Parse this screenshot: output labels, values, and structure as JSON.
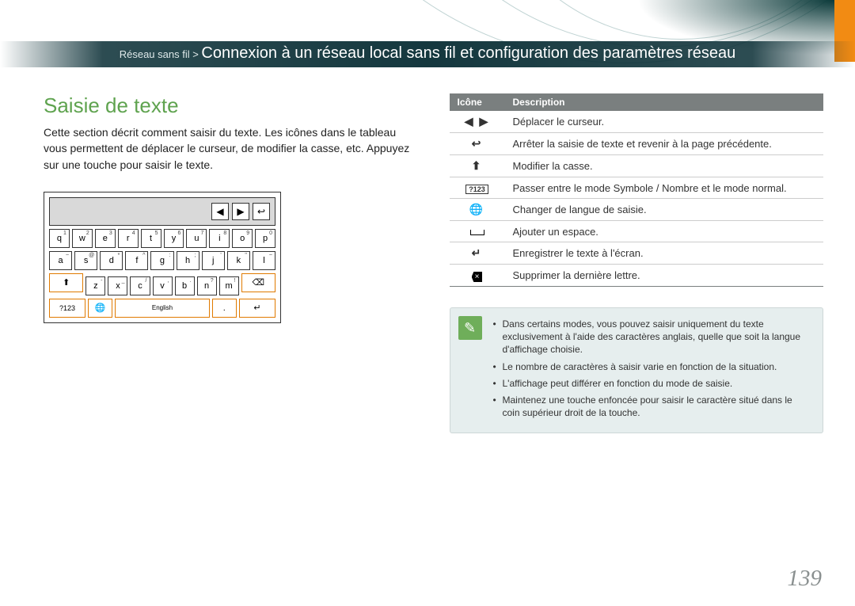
{
  "breadcrumb": {
    "prefix": "Réseau sans fil > ",
    "title": "Connexion à un réseau local sans fil et configuration des paramètres réseau"
  },
  "section_title": "Saisie de texte",
  "intro": "Cette section décrit comment saisir du texte. Les icônes dans le tableau vous permettent de déplacer le curseur, de modifier la casse, etc. Appuyez sur une touche pour saisir le texte.",
  "keyboard": {
    "row1": [
      {
        "k": "q",
        "s": "1"
      },
      {
        "k": "w",
        "s": "2"
      },
      {
        "k": "e",
        "s": "3"
      },
      {
        "k": "r",
        "s": "4"
      },
      {
        "k": "t",
        "s": "5"
      },
      {
        "k": "y",
        "s": "6"
      },
      {
        "k": "u",
        "s": "7"
      },
      {
        "k": "i",
        "s": "8"
      },
      {
        "k": "o",
        "s": "9"
      },
      {
        "k": "p",
        "s": "0"
      }
    ],
    "row2": [
      {
        "k": "a",
        "s": "~"
      },
      {
        "k": "s",
        "s": "@"
      },
      {
        "k": "d",
        "s": "*"
      },
      {
        "k": "f",
        "s": "^"
      },
      {
        "k": "g",
        "s": ":"
      },
      {
        "k": "h",
        "s": ";"
      },
      {
        "k": "j",
        "s": "'"
      },
      {
        "k": "k",
        "s": "\""
      },
      {
        "k": "l",
        "s": "~"
      }
    ],
    "row3": [
      {
        "k": "z",
        "s": "-"
      },
      {
        "k": "x",
        "s": "_"
      },
      {
        "k": "c",
        "s": "/"
      },
      {
        "k": "v",
        "s": ","
      },
      {
        "k": "b",
        "s": "."
      },
      {
        "k": "n",
        "s": "?"
      },
      {
        "k": "m",
        "s": "!"
      }
    ],
    "mode_key": "?123",
    "lang_key": "English",
    "dot_key": ".",
    "shift_icon": "⬆",
    "back_icon": "⌫",
    "enter_icon": "↵",
    "left_icon": "◀",
    "right_icon": "▶",
    "return_icon": "↩"
  },
  "table": {
    "headers": {
      "icon": "Icône",
      "desc": "Description"
    },
    "rows": [
      {
        "icon": "◀ ▶",
        "desc": "Déplacer le curseur."
      },
      {
        "icon": "↩",
        "desc": "Arrêter la saisie de texte et revenir à la page précédente."
      },
      {
        "icon": "⬆",
        "desc": "Modifier la casse."
      },
      {
        "icon": "?123",
        "desc": "Passer entre le mode Symbole / Nombre et le mode normal."
      },
      {
        "icon": "🌐",
        "desc": "Changer de langue de saisie."
      },
      {
        "icon": "␣",
        "desc": "Ajouter un espace."
      },
      {
        "icon": "↵",
        "desc": "Enregistrer le texte à l'écran."
      },
      {
        "icon": "⌫",
        "desc": "Supprimer la dernière lettre."
      }
    ]
  },
  "note": {
    "items": [
      "Dans certains modes, vous pouvez saisir uniquement du texte exclusivement à l'aide des caractères anglais, quelle que soit la langue d'affichage choisie.",
      "Le nombre de caractères à saisir varie en fonction de la situation.",
      "L'affichage peut différer en fonction du mode de saisie.",
      "Maintenez une touche enfoncée pour saisir le caractère situé dans le coin supérieur droit de la touche."
    ]
  },
  "page_number": "139"
}
